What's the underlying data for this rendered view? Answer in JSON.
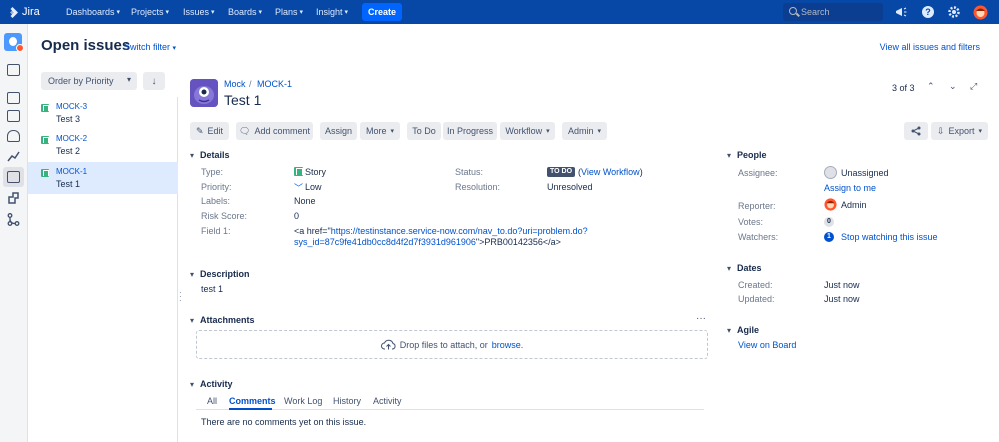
{
  "topnav": {
    "logo": "Jira",
    "items": [
      "Dashboards",
      "Projects",
      "Issues",
      "Boards",
      "Plans",
      "Insight"
    ],
    "create": "Create",
    "search_placeholder": "Search"
  },
  "header": {
    "title": "Open issues",
    "switch_filter": "Switch filter",
    "view_all": "View all issues and filters"
  },
  "list": {
    "order_by": "Order by Priority",
    "items": [
      {
        "key": "MOCK-3",
        "summary": "Test 3"
      },
      {
        "key": "MOCK-2",
        "summary": "Test 2"
      },
      {
        "key": "MOCK-1",
        "summary": "Test 1"
      }
    ]
  },
  "issue": {
    "project": "Mock",
    "key": "MOCK-1",
    "title": "Test 1",
    "pager": "3 of 3"
  },
  "toolbar": {
    "edit": "Edit",
    "add_comment": "Add comment",
    "assign": "Assign",
    "more": "More",
    "todo": "To Do",
    "in_progress": "In Progress",
    "workflow": "Workflow",
    "admin": "Admin",
    "export": "Export"
  },
  "details": {
    "heading": "Details",
    "type_label": "Type:",
    "type_value": "Story",
    "priority_label": "Priority:",
    "priority_value": "Low",
    "labels_label": "Labels:",
    "labels_value": "None",
    "risk_label": "Risk Score:",
    "risk_value": "0",
    "field1_label": "Field 1:",
    "field1_prefix": "<a href=\"",
    "field1_link_line1": "https://testinstance.service-now.com/nav_to.do?uri=problem.do?",
    "field1_link_line2": "sys_id=87c9fe41db0cc8d4f2d7f3931d961906",
    "field1_suffix": "\">PRB00142356</a>",
    "status_label": "Status:",
    "status_badge": "TO DO",
    "status_link": "View Workflow",
    "resolution_label": "Resolution:",
    "resolution_value": "Unresolved"
  },
  "description": {
    "heading": "Description",
    "text": "test 1"
  },
  "attachments": {
    "heading": "Attachments",
    "drop_text": "Drop files to attach, or",
    "browse": "browse."
  },
  "activity": {
    "heading": "Activity",
    "tabs": [
      "All",
      "Comments",
      "Work Log",
      "History",
      "Activity"
    ],
    "active_tab": "Comments",
    "empty": "There are no comments yet on this issue."
  },
  "people": {
    "heading": "People",
    "assignee_label": "Assignee:",
    "assignee_value": "Unassigned",
    "assign_to_me": "Assign to me",
    "reporter_label": "Reporter:",
    "reporter_value": "Admin",
    "votes_label": "Votes:",
    "votes_value": "0",
    "watchers_label": "Watchers:",
    "watchers_value": "1",
    "stop_watching": "Stop watching this issue"
  },
  "dates": {
    "heading": "Dates",
    "created_label": "Created:",
    "created_value": "Just now",
    "updated_label": "Updated:",
    "updated_value": "Just now"
  },
  "agile": {
    "heading": "Agile",
    "view_on_board": "View on Board"
  },
  "colors": {
    "nav": "#0747a6",
    "accent": "#0052cc",
    "story": "#36b37e",
    "selected_row": "#deebff"
  }
}
